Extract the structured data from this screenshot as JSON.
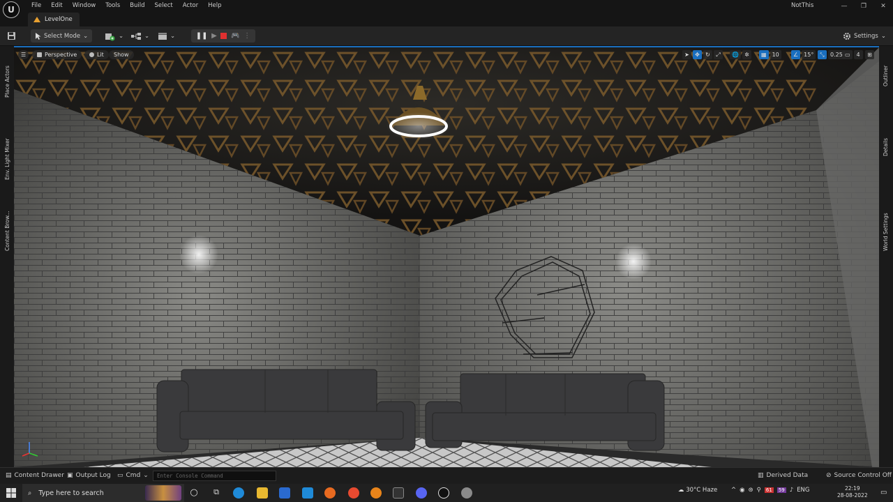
{
  "app": {
    "menu": [
      "File",
      "Edit",
      "Window",
      "Tools",
      "Build",
      "Select",
      "Actor",
      "Help"
    ],
    "project_name": "NotThis",
    "logo_letter": "U",
    "window_controls": {
      "minimize": "—",
      "restore": "❐",
      "close": "✕"
    }
  },
  "tab": {
    "label": "LevelOne"
  },
  "toolbar": {
    "save_icon": "save-icon",
    "select_mode_label": "Select Mode",
    "settings_label": "Settings"
  },
  "left_panel": {
    "tabs": [
      "Place Actors",
      "Env. Light Mixer",
      "Content Brow..."
    ]
  },
  "right_panel": {
    "tabs": [
      "Outliner",
      "Details",
      "World Settings"
    ]
  },
  "viewport": {
    "view_mode": "Perspective",
    "lighting_mode": "Lit",
    "show_label": "Show",
    "grid_snap": "10",
    "rotation_snap": "15°",
    "scale_snap": "0.25",
    "camera_speed": "4"
  },
  "statusbar": {
    "content_drawer": "Content Drawer",
    "output_log": "Output Log",
    "cmd": "Cmd",
    "console_placeholder": "Enter Console Command",
    "derived_data": "Derived Data",
    "source_control": "Source Control Off"
  },
  "taskbar": {
    "search_placeholder": "Type here to search",
    "weather_temp": "30°C",
    "weather_desc": "Haze",
    "lang": "ENG",
    "time": "22:19",
    "date": "28-08-2022",
    "badge_1": "61",
    "badge_2": "59"
  },
  "colors": {
    "accent": "#1a6fbf",
    "play_stop": "#e03030",
    "level_icon": "#e8a030"
  }
}
